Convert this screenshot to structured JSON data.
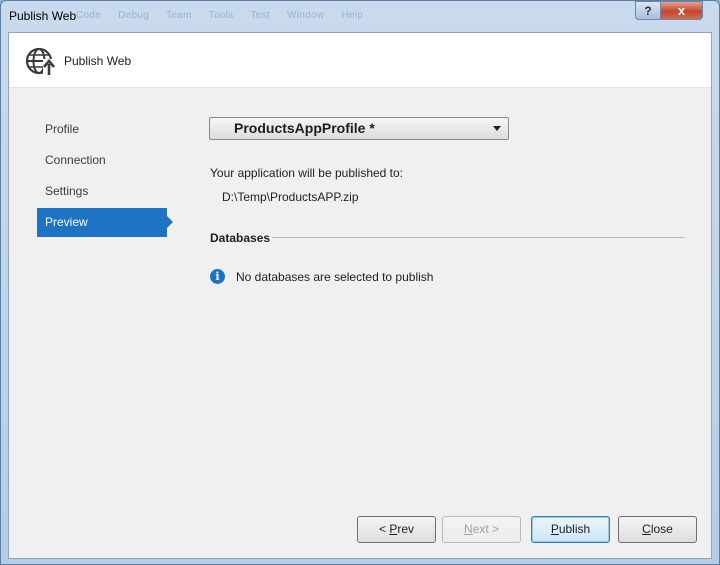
{
  "window": {
    "title": "Publish Web",
    "ghost_menu": [
      "Code",
      "Debug",
      "Team",
      "Tools",
      "Test",
      "Window",
      "Help"
    ],
    "help_label": "?",
    "close_label": "x"
  },
  "header": {
    "title": "Publish Web",
    "icon": "globe-publish-icon"
  },
  "nav": {
    "items": [
      {
        "label": "Profile"
      },
      {
        "label": "Connection"
      },
      {
        "label": "Settings"
      },
      {
        "label": "Preview"
      }
    ],
    "active": "Preview"
  },
  "profile": {
    "selected": "ProductsAppProfile *"
  },
  "preview": {
    "publish_label": "Your application will be published to:",
    "publish_path": "D:\\Temp\\ProductsAPP.zip",
    "databases_heading": "Databases",
    "no_databases": "No databases are selected to publish",
    "info_icon": "i"
  },
  "buttons": {
    "prev": {
      "pre": "< ",
      "u": "P",
      "post": "rev"
    },
    "next": {
      "pre": "",
      "u": "N",
      "post": "ext >"
    },
    "publish": {
      "pre": "",
      "u": "P",
      "post": "ublish"
    },
    "close": {
      "pre": "",
      "u": "C",
      "post": "lose"
    }
  },
  "colors": {
    "accent": "#1f73c4",
    "window_frame": "#b7cde6",
    "close_button": "#c5452c"
  }
}
